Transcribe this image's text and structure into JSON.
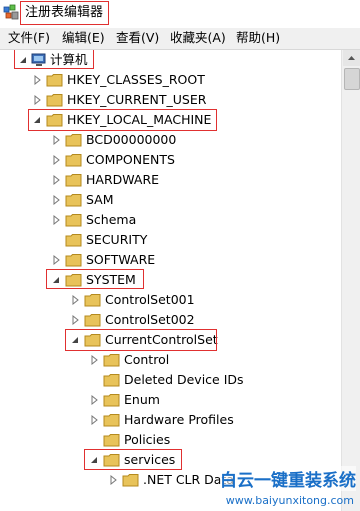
{
  "window": {
    "title": "注册表编辑器"
  },
  "menu": [
    "文件(F)",
    "编辑(E)",
    "查看(V)",
    "收藏夹(A)",
    "帮助(H)"
  ],
  "tree": {
    "root": "计算机",
    "hives": [
      "HKEY_CLASSES_ROOT",
      "HKEY_CURRENT_USER",
      "HKEY_LOCAL_MACHINE"
    ],
    "hklm_children": [
      "BCD00000000",
      "COMPONENTS",
      "HARDWARE",
      "SAM",
      "Schema",
      "SECURITY",
      "SOFTWARE",
      "SYSTEM"
    ],
    "system_children": [
      "ControlSet001",
      "ControlSet002",
      "CurrentControlSet"
    ],
    "ccs_children": [
      "Control",
      "Deleted Device IDs",
      "Enum",
      "Hardware Profiles",
      "Policies",
      "services"
    ],
    "services_children": [
      ".NET CLR Data"
    ]
  },
  "watermark": {
    "text": "白云一键重装系统",
    "url": "www.baiyunxitong.com"
  },
  "colors": {
    "highlight_border": "#e03030",
    "folder": "#e8c35a",
    "watermark": "#1a6fc7"
  }
}
